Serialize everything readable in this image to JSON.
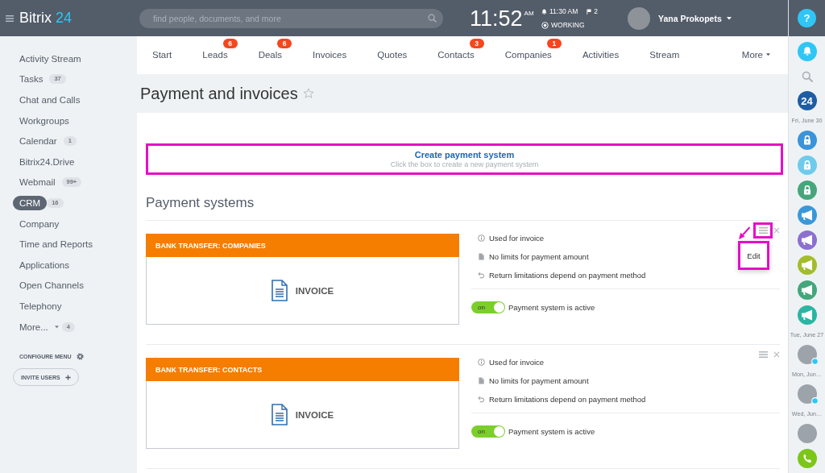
{
  "header": {
    "logo": {
      "name": "Bitrix",
      "number": "24"
    },
    "search": {
      "placeholder": "find people, documents, and more"
    },
    "clock": {
      "time": "11:52",
      "meridiem": "AM"
    },
    "alarm": "11:30 AM",
    "flags": "2",
    "work_status": "WORKING",
    "user": {
      "name": "Yana Prokopets"
    }
  },
  "sidebar": {
    "items": [
      {
        "kind": "link",
        "label": "Activity Stream",
        "selected": false
      },
      {
        "kind": "link",
        "label": "Tasks",
        "count": "37",
        "selected": false
      },
      {
        "kind": "link",
        "label": "Chat and Calls",
        "selected": false
      },
      {
        "kind": "link",
        "label": "Workgroups",
        "selected": false
      },
      {
        "kind": "link",
        "label": "Calendar",
        "count": "1",
        "selected": false
      },
      {
        "kind": "link",
        "label": "Bitrix24.Drive",
        "selected": false
      },
      {
        "kind": "link",
        "label": "Webmail",
        "count": "99+",
        "selected": false
      },
      {
        "kind": "link",
        "label": "CRM",
        "count": "16",
        "selected": true
      },
      {
        "kind": "link",
        "label": "Company",
        "selected": false
      },
      {
        "kind": "link",
        "label": "Time and Reports",
        "selected": false
      },
      {
        "kind": "link",
        "label": "Applications",
        "selected": false
      },
      {
        "kind": "link",
        "label": "Open Channels",
        "selected": false
      },
      {
        "kind": "link",
        "label": "Telephony",
        "selected": false
      },
      {
        "kind": "more",
        "label": "More...",
        "count": "4",
        "selected": false
      }
    ],
    "configure": "CONFIGURE MENU",
    "invite": "INVITE USERS"
  },
  "tabs": [
    {
      "label": "Start",
      "selected": false
    },
    {
      "label": "Leads",
      "badge": "6",
      "selected": false
    },
    {
      "label": "Deals",
      "badge": "6",
      "selected": false
    },
    {
      "label": "Invoices",
      "selected": false
    },
    {
      "label": "Quotes",
      "selected": false
    },
    {
      "label": "Contacts",
      "badge": "3",
      "selected": false
    },
    {
      "label": "Companies",
      "badge": "1",
      "selected": false
    },
    {
      "label": "Activities",
      "selected": false
    },
    {
      "label": "Stream",
      "selected": false
    }
  ],
  "more_tab": "More",
  "page": {
    "title": "Payment and invoices",
    "favorite": false
  },
  "create": {
    "title": "Create payment system",
    "hint": "Click the box to create a new payment system",
    "highlighted": true
  },
  "section_title": "Payment systems",
  "systems": [
    {
      "title": "BANK TRANSFER: COMPANIES",
      "document": "INVOICE",
      "features": [
        {
          "kind": "info",
          "text": "Used for invoice"
        },
        {
          "kind": "limit",
          "text": "No limits for payment amount"
        },
        {
          "kind": "return",
          "text": "Return limitations depend on payment method"
        }
      ],
      "active": true,
      "switch_label": "on",
      "status": "Payment system is active",
      "menu_highlighted": true,
      "menu_items": [
        "Edit"
      ]
    },
    {
      "title": "BANK TRANSFER: CONTACTS",
      "document": "INVOICE",
      "features": [
        {
          "kind": "info",
          "text": "Used for invoice"
        },
        {
          "kind": "limit",
          "text": "No limits for payment amount"
        },
        {
          "kind": "return",
          "text": "Return limitations depend on payment method"
        }
      ],
      "active": true,
      "switch_label": "on",
      "status": "Payment system is active",
      "menu_highlighted": false
    }
  ],
  "help": "?",
  "rightbar": {
    "items": [
      {
        "kind": "bell",
        "color": "#2fc6f6"
      },
      {
        "kind": "search"
      },
      {
        "kind": "logo",
        "text": "24",
        "color": "#1f5da3"
      },
      {
        "kind": "date",
        "text": "Fri, June 30"
      },
      {
        "kind": "lock",
        "color": "#3b94d9"
      },
      {
        "kind": "lock",
        "color": "#6fcbec"
      },
      {
        "kind": "lock",
        "color": "#47a57c"
      },
      {
        "kind": "megaphone",
        "color": "#3b98d8"
      },
      {
        "kind": "megaphone",
        "color": "#8c70d0"
      },
      {
        "kind": "megaphone",
        "color": "#a3bc2e"
      },
      {
        "kind": "megaphone",
        "color": "#43a77c"
      },
      {
        "kind": "megaphone",
        "color": "#2bb5a3"
      },
      {
        "kind": "date",
        "text": "Tue, June 27"
      },
      {
        "kind": "photo",
        "online": true
      },
      {
        "kind": "date",
        "text": "Mon, Jun…"
      },
      {
        "kind": "photo",
        "online": true
      },
      {
        "kind": "date",
        "text": "Wed, Jun…"
      },
      {
        "kind": "photo",
        "online": false
      },
      {
        "kind": "phone",
        "color": "#7cc61a"
      }
    ]
  }
}
